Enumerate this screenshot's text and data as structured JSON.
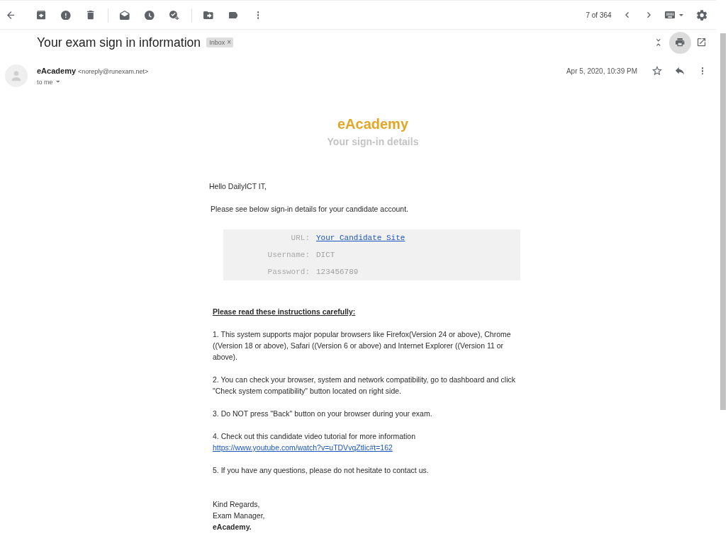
{
  "toolbar": {
    "pager": "7 of 364"
  },
  "message": {
    "subject": "Your exam sign in information",
    "labels": [
      {
        "name": "Inbox",
        "remove": "×"
      }
    ],
    "thread_actions": [
      {
        "kind": "collapse",
        "highlighted": false
      },
      {
        "kind": "print",
        "highlighted": true
      },
      {
        "kind": "new-window",
        "highlighted": false
      }
    ],
    "sender": {
      "name": "eAcademy",
      "email": "<noreply@runexam.net>"
    },
    "recipients": "to me",
    "date": "Apr 5, 2020, 10:39 PM"
  },
  "body": {
    "brand": "eAcademy",
    "heading": "Your sign-in details",
    "greeting": "Hello DailyICT IT,",
    "intro": "Please see below sign-in details for your candidate account.",
    "credentials": [
      {
        "label": "URL:",
        "value": "Your Candidate Site",
        "kind": "link"
      },
      {
        "label": "Username:",
        "value": "DICT",
        "kind": "text"
      },
      {
        "label": "Password:",
        "value": "123456789",
        "kind": "text"
      }
    ],
    "instructions_heading": "Please read these instructions carefully:",
    "instructions": [
      {
        "text": "1. This system supports major popular browsers like Firefox(Version 24 or above), Chrome ((Version 18 or above), Safari ((Version 6 or above) and Internet Explorer ((Version 11 or above)."
      },
      {
        "text": "2. You can check your browser, system and network compatibility, go to dashboard and click \"Check system compatibility\" button located on right side."
      },
      {
        "text": "3. Do NOT press \"Back\" button on your browser during your exam."
      },
      {
        "text": "4. Check out this candidate video tutorial for more information",
        "link": "https://www.youtube.com/watch?v=uTDVvqZtlic#t=162"
      },
      {
        "text": "5. If you have any questions, please do not hesitate to contact us."
      }
    ],
    "signature": [
      {
        "text": "Kind Regards,",
        "bold": false
      },
      {
        "text": "Exam Manager,",
        "bold": false
      },
      {
        "text": "eAcademy.",
        "bold": true
      }
    ]
  }
}
